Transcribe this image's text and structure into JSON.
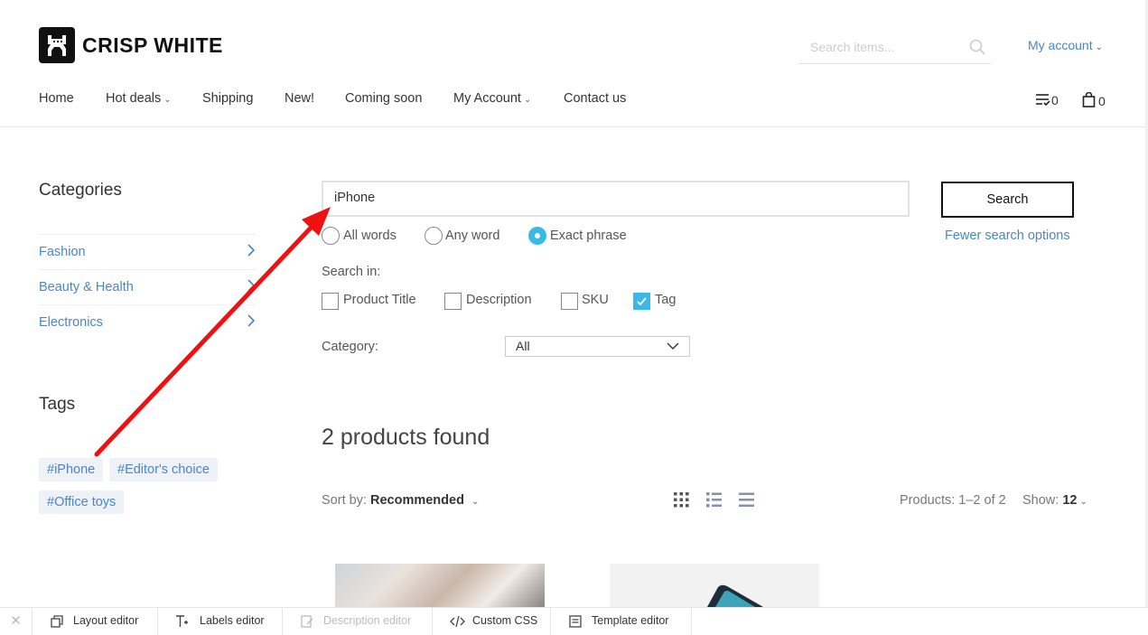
{
  "header": {
    "logo_text": "CRISP WHITE",
    "search_placeholder": "Search items...",
    "account_label": "My account"
  },
  "nav": {
    "items": [
      {
        "label": "Home"
      },
      {
        "label": "Hot deals"
      },
      {
        "label": "Shipping"
      },
      {
        "label": "New!"
      },
      {
        "label": "Coming soon"
      },
      {
        "label": "My Account"
      },
      {
        "label": "Contact us"
      }
    ],
    "favorites_count": "0",
    "cart_count": "0"
  },
  "sidebar": {
    "categories_title": "Categories",
    "categories": [
      {
        "label": "Fashion"
      },
      {
        "label": "Beauty & Health"
      },
      {
        "label": "Electronics"
      }
    ],
    "tags_title": "Tags",
    "tags": [
      {
        "label": "#iPhone"
      },
      {
        "label": "#Editor's choice"
      },
      {
        "label": "#Office toys"
      }
    ]
  },
  "search": {
    "query": "iPhone",
    "button_label": "Search",
    "mode_options": [
      {
        "label": "All words",
        "selected": false
      },
      {
        "label": "Any word",
        "selected": false
      },
      {
        "label": "Exact phrase",
        "selected": true
      }
    ],
    "fewer_options_label": "Fewer search options",
    "search_in_label": "Search in:",
    "search_in_options": [
      {
        "label": "Product Title",
        "checked": false
      },
      {
        "label": "Description",
        "checked": false
      },
      {
        "label": "SKU",
        "checked": false
      },
      {
        "label": "Tag",
        "checked": true
      }
    ],
    "category_label": "Category:",
    "category_value": "All"
  },
  "results": {
    "found_text": "2 products found",
    "sort_prefix": "Sort by:",
    "sort_value": "Recommended",
    "products_range": "Products: 1–2 of 2",
    "show_prefix": "Show:",
    "show_value": "12"
  },
  "toolbar": {
    "items": [
      {
        "label": "Layout editor",
        "icon": "layout-icon",
        "disabled": false
      },
      {
        "label": "Labels editor",
        "icon": "text-icon",
        "disabled": false
      },
      {
        "label": "Description editor",
        "icon": "edit-icon",
        "disabled": true
      },
      {
        "label": "Custom CSS",
        "icon": "code-icon",
        "disabled": false
      },
      {
        "label": "Template editor",
        "icon": "template-icon",
        "disabled": false
      }
    ]
  },
  "colors": {
    "accent": "#39b9e6",
    "link": "#4a86c5",
    "annotation_arrow": "#ee1111"
  }
}
